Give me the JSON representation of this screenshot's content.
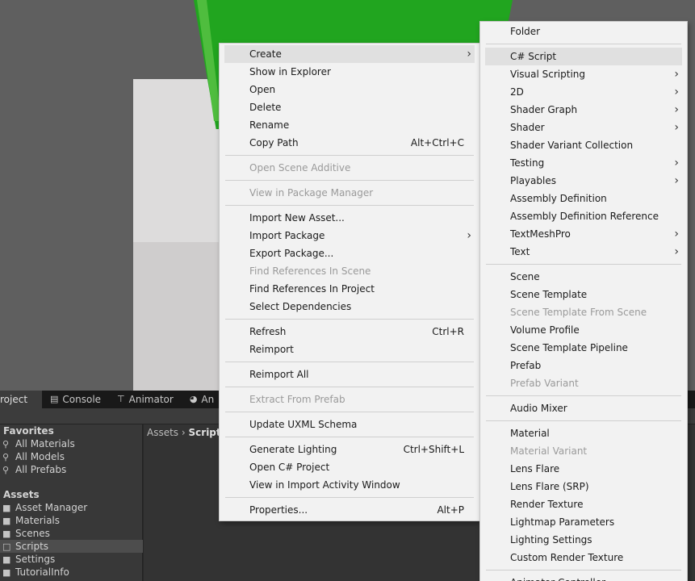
{
  "bottom_panel": {
    "tabs": [
      {
        "label": "roject",
        "icon": "folder-icon"
      },
      {
        "label": "Console",
        "icon": "console-icon"
      },
      {
        "label": "Animator",
        "icon": "animator-icon"
      },
      {
        "label": "An",
        "icon": "animation-icon"
      }
    ],
    "favorites_label": "Favorites",
    "favorites": [
      "All Materials",
      "All Models",
      "All Prefabs"
    ],
    "assets_label": "Assets",
    "folders": [
      "Asset Manager",
      "Materials",
      "Scenes",
      "Scripts",
      "Settings",
      "TutorialInfo"
    ],
    "breadcrumb": {
      "root": "Assets",
      "current": "Scripts"
    }
  },
  "context_menu": {
    "create": "Create",
    "show_in_explorer": "Show in Explorer",
    "open": "Open",
    "delete": "Delete",
    "rename": "Rename",
    "copy_path": "Copy Path",
    "copy_path_shortcut": "Alt+Ctrl+C",
    "open_scene_additive": "Open Scene Additive",
    "view_in_package_manager": "View in Package Manager",
    "import_new_asset": "Import New Asset...",
    "import_package": "Import Package",
    "export_package": "Export Package...",
    "find_references_in_scene": "Find References In Scene",
    "find_references_in_project": "Find References In Project",
    "select_dependencies": "Select Dependencies",
    "refresh": "Refresh",
    "refresh_shortcut": "Ctrl+R",
    "reimport": "Reimport",
    "reimport_all": "Reimport All",
    "extract_from_prefab": "Extract From Prefab",
    "update_uxml_schema": "Update UXML Schema",
    "generate_lighting": "Generate Lighting",
    "generate_lighting_shortcut": "Ctrl+Shift+L",
    "open_csharp_project": "Open C# Project",
    "view_in_import_activity_window": "View in Import Activity Window",
    "properties": "Properties...",
    "properties_shortcut": "Alt+P"
  },
  "create_submenu": {
    "folder": "Folder",
    "csharp_script": "C# Script",
    "visual_scripting": "Visual Scripting",
    "twod": "2D",
    "shader_graph": "Shader Graph",
    "shader": "Shader",
    "shader_variant_collection": "Shader Variant Collection",
    "testing": "Testing",
    "playables": "Playables",
    "assembly_definition": "Assembly Definition",
    "assembly_definition_reference": "Assembly Definition Reference",
    "textmeshpro": "TextMeshPro",
    "text": "Text",
    "scene": "Scene",
    "scene_template": "Scene Template",
    "scene_template_from_scene": "Scene Template From Scene",
    "volume_profile": "Volume Profile",
    "scene_template_pipeline": "Scene Template Pipeline",
    "prefab": "Prefab",
    "prefab_variant": "Prefab Variant",
    "audio_mixer": "Audio Mixer",
    "material": "Material",
    "material_variant": "Material Variant",
    "lens_flare": "Lens Flare",
    "lens_flare_srp": "Lens Flare (SRP)",
    "render_texture": "Render Texture",
    "lightmap_parameters": "Lightmap Parameters",
    "lighting_settings": "Lighting Settings",
    "custom_render_texture": "Custom Render Texture",
    "animator_controller": "Animator Controller"
  },
  "colors": {
    "menu_bg": "#f2f2f2",
    "menu_highlight": "#e0e0e0",
    "disabled_text": "#9a9a9a",
    "scene_green": "#21a51f",
    "panel_bg": "#282828"
  }
}
